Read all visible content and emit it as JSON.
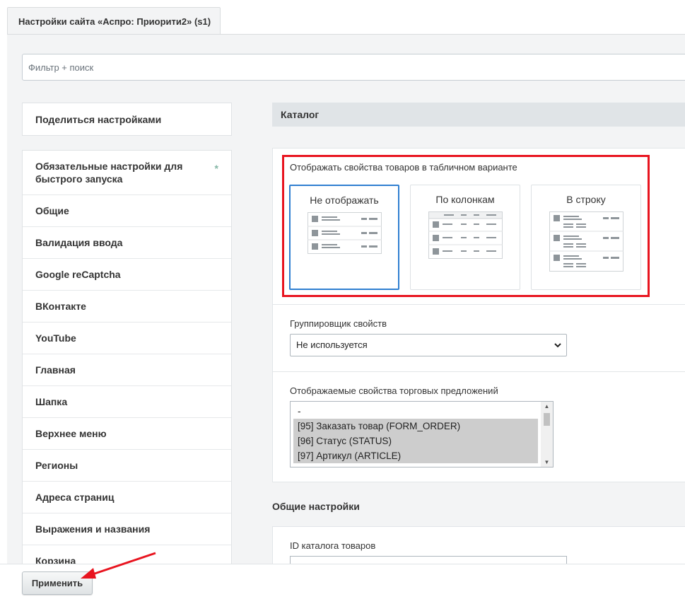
{
  "tab": {
    "label": "Настройки сайта «Аспро: Приорити2» (s1)"
  },
  "filter": {
    "placeholder": "Фильтр + поиск"
  },
  "share": {
    "label": "Поделиться настройками"
  },
  "menu": {
    "items": [
      {
        "label": "Обязательные настройки для быстрого запуска",
        "marker": "*"
      },
      {
        "label": "Общие"
      },
      {
        "label": "Валидация ввода"
      },
      {
        "label": "Google reCaptcha"
      },
      {
        "label": "ВКонтакте"
      },
      {
        "label": "YouTube"
      },
      {
        "label": "Главная"
      },
      {
        "label": "Шапка"
      },
      {
        "label": "Верхнее меню"
      },
      {
        "label": "Регионы"
      },
      {
        "label": "Адреса страниц"
      },
      {
        "label": "Выражения и названия"
      },
      {
        "label": "Корзина"
      }
    ]
  },
  "catalog": {
    "heading": "Каталог",
    "table_props_label": "Отображать свойства товаров в табличном варианте",
    "options": [
      {
        "label": "Не отображать",
        "selected": true
      },
      {
        "label": "По колонкам",
        "selected": false
      },
      {
        "label": "В строку",
        "selected": false
      }
    ],
    "grouper_label": "Группировщик свойств",
    "grouper_value": "Не используется",
    "offers_label": "Отображаемые свойства торговых предложений",
    "offers_options": [
      {
        "label": "-",
        "selected": false
      },
      {
        "label": "[95] Заказать товар (FORM_ORDER)",
        "selected": true
      },
      {
        "label": "[96] Статус (STATUS)",
        "selected": true
      },
      {
        "label": "[97] Артикул (ARTICLE)",
        "selected": true
      }
    ]
  },
  "general": {
    "heading": "Общие настройки",
    "catalog_id_label": "ID каталога товаров"
  },
  "footer": {
    "apply_label": "Применить"
  },
  "colors": {
    "highlight_red": "#e8141f",
    "selected_blue": "#2f7fd1",
    "panel_gray": "#f3f4f5"
  }
}
